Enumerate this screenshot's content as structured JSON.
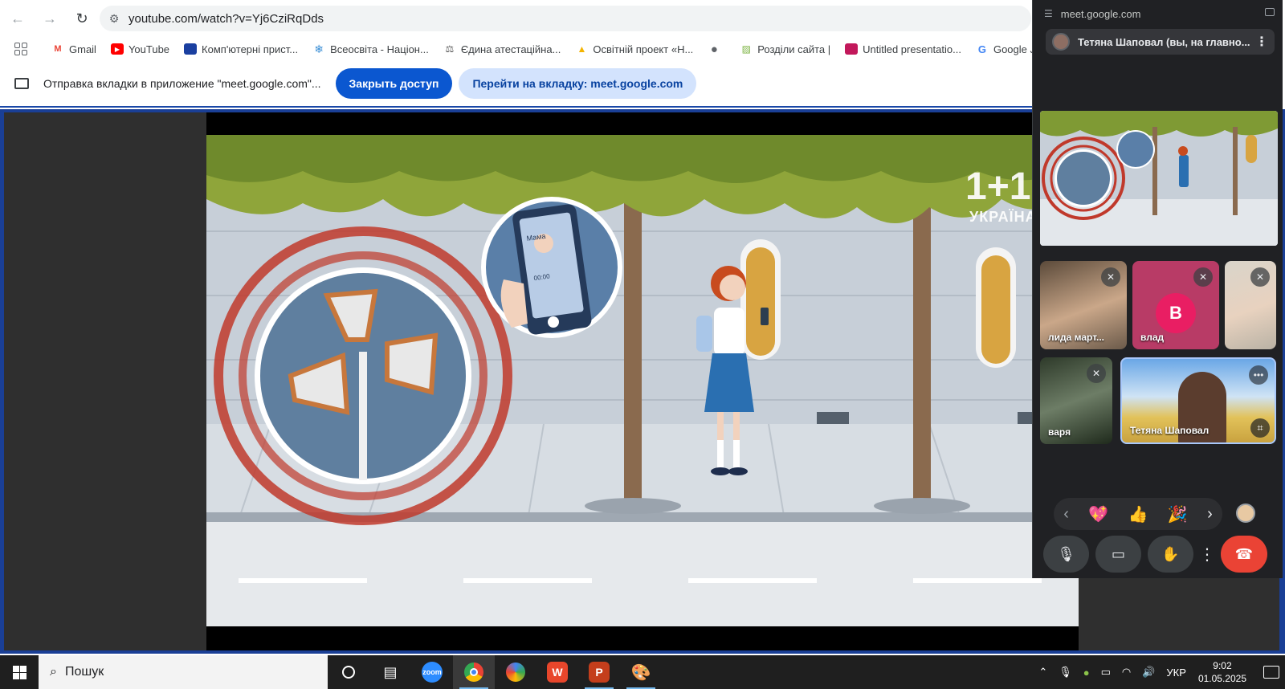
{
  "browser": {
    "url": "youtube.com/watch?v=Yj6CziRqDds",
    "bookmarks": [
      {
        "label": "Gmail",
        "icon": "gmail-icon",
        "color": "#ea4335"
      },
      {
        "label": "YouTube",
        "icon": "youtube-icon",
        "color": "#ff0000"
      },
      {
        "label": "Комп'ютерні прист...",
        "icon": "book-icon",
        "color": "#1a3fa0"
      },
      {
        "label": "Всеосвіта - Націон...",
        "icon": "snowflake-icon",
        "color": "#3b8fd6"
      },
      {
        "label": "Єдина атестаційна...",
        "icon": "cac-icon",
        "color": "#555555"
      },
      {
        "label": "Освітній проект «Н...",
        "icon": "bell-icon",
        "color": "#f4b400"
      },
      {
        "label": "",
        "icon": "globe-icon",
        "color": "#5f6368"
      },
      {
        "label": "Розділи сайта |",
        "icon": "image-icon",
        "color": "#7cb342"
      },
      {
        "label": "Untitled presentatio...",
        "icon": "slides-icon",
        "color": "#c2185b"
      },
      {
        "label": "Google Jamboard",
        "icon": "google-icon",
        "color": "#4285f4"
      }
    ]
  },
  "infobar": {
    "message": "Отправка вкладки в приложение \"meet.google.com\"...",
    "stop_label": "Закрыть доступ",
    "switch_label": "Перейти на вкладку: meet.google.com"
  },
  "video": {
    "logo_main": "1+1",
    "logo_sub": "УКРАЇНА",
    "phone_caller": "Мама",
    "phone_time": "00:00"
  },
  "meet": {
    "domain": "meet.google.com",
    "presenter": "Тетяна Шаповал (вы, на главно...",
    "participants": [
      {
        "name": "лида март...",
        "muted": true
      },
      {
        "name": "влад",
        "initial": "B",
        "muted": true
      },
      {
        "name": "",
        "muted": true
      },
      {
        "name": "варя",
        "muted": true
      },
      {
        "name": "Тетяна Шаповал",
        "muted": false
      }
    ],
    "reactions": [
      "💖",
      "👍",
      "🎉"
    ],
    "colors": {
      "end_call": "#ea4335",
      "avatar_vlad": "#e91e63"
    }
  },
  "taskbar": {
    "search_placeholder": "Пошук",
    "apps": [
      "zoom",
      "chrome",
      "google-photos",
      "wps-office",
      "powerpoint",
      "paint"
    ],
    "lang": "УКР",
    "time": "9:02",
    "date": "01.05.2025"
  }
}
